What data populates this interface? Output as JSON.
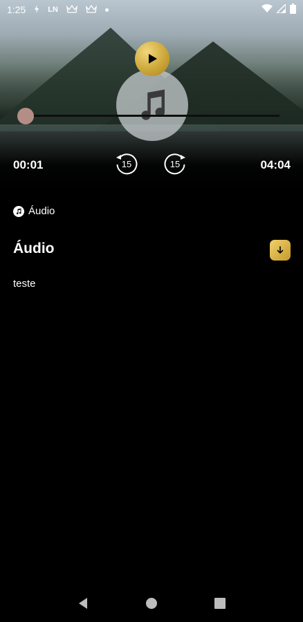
{
  "status_bar": {
    "time": "1:25",
    "icons": [
      "lightning-icon",
      "ln-badge",
      "crown-icon",
      "crown-icon",
      "dot-icon"
    ],
    "ln_label": "LN",
    "right_icons": [
      "wifi-icon",
      "signal-icon",
      "battery-icon"
    ]
  },
  "player": {
    "current_time": "00:01",
    "total_time": "04:04",
    "progress": 0.004,
    "skip_back_label": "15",
    "skip_forward_label": "15"
  },
  "content": {
    "category_label": "Áudio",
    "title": "Áudio",
    "description": "teste"
  },
  "colors": {
    "accent_gold": "#d4b04a",
    "background": "#000000",
    "seek_thumb": "#b48e86"
  },
  "nav": {
    "buttons": [
      "back",
      "home",
      "recents"
    ]
  }
}
